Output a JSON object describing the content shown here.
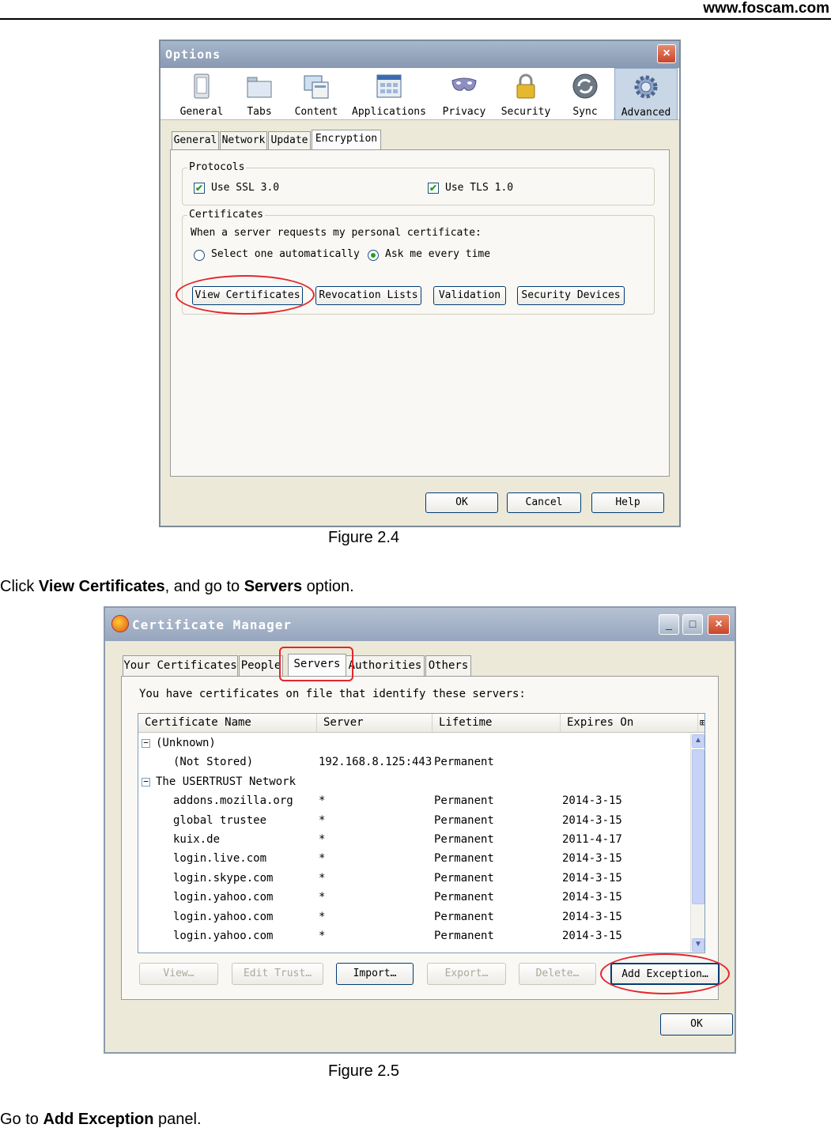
{
  "header": {
    "site": "www.foscam.com"
  },
  "options_window": {
    "title": "Options",
    "close_glyph": "×",
    "toolbar": [
      {
        "label": "General",
        "icon": "general-icon"
      },
      {
        "label": "Tabs",
        "icon": "tabs-icon"
      },
      {
        "label": "Content",
        "icon": "content-icon"
      },
      {
        "label": "Applications",
        "icon": "applications-icon"
      },
      {
        "label": "Privacy",
        "icon": "privacy-mask-icon"
      },
      {
        "label": "Security",
        "icon": "padlock-icon"
      },
      {
        "label": "Sync",
        "icon": "sync-icon"
      },
      {
        "label": "Advanced",
        "icon": "gear-icon"
      }
    ],
    "active_toolbar": "Advanced",
    "subtabs": [
      "General",
      "Network",
      "Update",
      "Encryption"
    ],
    "active_subtab": "Encryption",
    "protocols_label": "Protocols",
    "ssl_label": "Use SSL 3.0",
    "tls_label": "Use TLS 1.0",
    "ssl_checked": true,
    "tls_checked": true,
    "check_glyph": "✔",
    "certificates_label": "Certificates",
    "cert_prompt": "When a server requests my personal certificate:",
    "radio_auto": "Select one automatically",
    "radio_ask": "Ask me every time",
    "selected_radio": "Ask me every time",
    "buttons": {
      "view_certificates": "View Certificates",
      "revocation_lists": "Revocation Lists",
      "validation": "Validation",
      "security_devices": "Security Devices"
    },
    "footer_buttons": {
      "ok": "OK",
      "cancel": "Cancel",
      "help": "Help"
    }
  },
  "caption_1": "Figure 2.4",
  "instruction_1": {
    "prefix": "Click ",
    "bold1": "View Certificates",
    "middle": ", and go to ",
    "bold2": "Servers",
    "suffix": " option."
  },
  "cert_manager": {
    "title": "Certificate Manager",
    "caption_buttons": {
      "minimize": "_",
      "maximize": "□",
      "close": "×"
    },
    "tabs": [
      "Your Certificates",
      "People",
      "Servers",
      "Authorities",
      "Others"
    ],
    "active_tab": "Servers",
    "description": "You have certificates on file that identify these servers:",
    "columns": [
      "Certificate Name",
      "Server",
      "Lifetime",
      "Expires On"
    ],
    "column_picker_glyph": "⊞",
    "rows": [
      {
        "name": "(Unknown)",
        "server": "",
        "lifetime": "",
        "expires": "",
        "group": true,
        "twisty": "−"
      },
      {
        "name": "(Not Stored)",
        "server": "192.168.8.125:443",
        "lifetime": "Permanent",
        "expires": "",
        "group": false,
        "twisty": ""
      },
      {
        "name": "The USERTRUST Network",
        "server": "",
        "lifetime": "",
        "expires": "",
        "group": true,
        "twisty": "−"
      },
      {
        "name": "addons.mozilla.org",
        "server": "*",
        "lifetime": "Permanent",
        "expires": "2014-3-15",
        "group": false,
        "twisty": ""
      },
      {
        "name": "global trustee",
        "server": "*",
        "lifetime": "Permanent",
        "expires": "2014-3-15",
        "group": false,
        "twisty": ""
      },
      {
        "name": "kuix.de",
        "server": "*",
        "lifetime": "Permanent",
        "expires": "2011-4-17",
        "group": false,
        "twisty": ""
      },
      {
        "name": "login.live.com",
        "server": "*",
        "lifetime": "Permanent",
        "expires": "2014-3-15",
        "group": false,
        "twisty": ""
      },
      {
        "name": "login.skype.com",
        "server": "*",
        "lifetime": "Permanent",
        "expires": "2014-3-15",
        "group": false,
        "twisty": ""
      },
      {
        "name": "login.yahoo.com",
        "server": "*",
        "lifetime": "Permanent",
        "expires": "2014-3-15",
        "group": false,
        "twisty": ""
      },
      {
        "name": "login.yahoo.com",
        "server": "*",
        "lifetime": "Permanent",
        "expires": "2014-3-15",
        "group": false,
        "twisty": ""
      },
      {
        "name": "login.yahoo.com",
        "server": "*",
        "lifetime": "Permanent",
        "expires": "2014-3-15",
        "group": false,
        "twisty": ""
      }
    ],
    "scroll_glyphs": {
      "up": "▲",
      "down": "▼"
    },
    "action_buttons": [
      {
        "label": "View…",
        "enabled": false
      },
      {
        "label": "Edit Trust…",
        "enabled": false
      },
      {
        "label": "Import…",
        "enabled": true
      },
      {
        "label": "Export…",
        "enabled": false
      },
      {
        "label": "Delete…",
        "enabled": false
      },
      {
        "label": "Add Exception…",
        "enabled": true
      }
    ],
    "ok_button": "OK"
  },
  "caption_2": "Figure 2.5",
  "instruction_2": {
    "prefix": "Go to ",
    "bold": "Add Exception",
    "suffix": " panel."
  },
  "colors": {
    "highlight_red": "#e3262d",
    "dialog_bg": "#ece9d8",
    "check_green": "#21a121"
  }
}
